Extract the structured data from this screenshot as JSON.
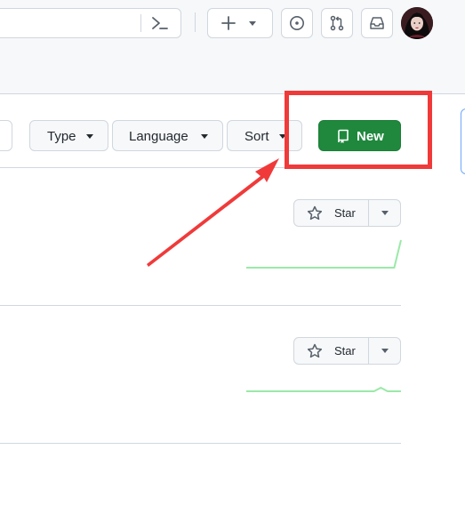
{
  "header": {
    "command_palette": {
      "icon": "terminal-prompt-icon"
    },
    "create_menu": {
      "icon": "plus-icon",
      "caret_icon": "triangle-down-icon"
    },
    "issues_icon": "issue-opened-icon",
    "pull_requests_icon": "git-pull-request-icon",
    "inbox_icon": "inbox-icon",
    "avatar": "user-avatar"
  },
  "filters": {
    "type_label": "Type",
    "language_label": "Language",
    "sort_label": "Sort",
    "new_label": "New",
    "new_icon": "repo-icon"
  },
  "repos": [
    {
      "star_label": "Star",
      "activity": [
        0,
        0,
        0,
        0,
        0,
        0,
        0,
        0,
        0,
        0,
        0,
        0,
        0,
        0,
        0,
        0,
        0,
        0,
        0,
        0,
        0,
        0,
        0,
        1
      ]
    },
    {
      "star_label": "Star",
      "activity": [
        0,
        0,
        0,
        0,
        0,
        0,
        0,
        0,
        0,
        0,
        0,
        0,
        0,
        0,
        0,
        0,
        0,
        0,
        0,
        0,
        1,
        0,
        0,
        0
      ]
    }
  ],
  "colors": {
    "primary": "#1f883d",
    "annotation": "#f03a3a",
    "sparkline": "#9be9a8",
    "border": "#d0d7de"
  }
}
